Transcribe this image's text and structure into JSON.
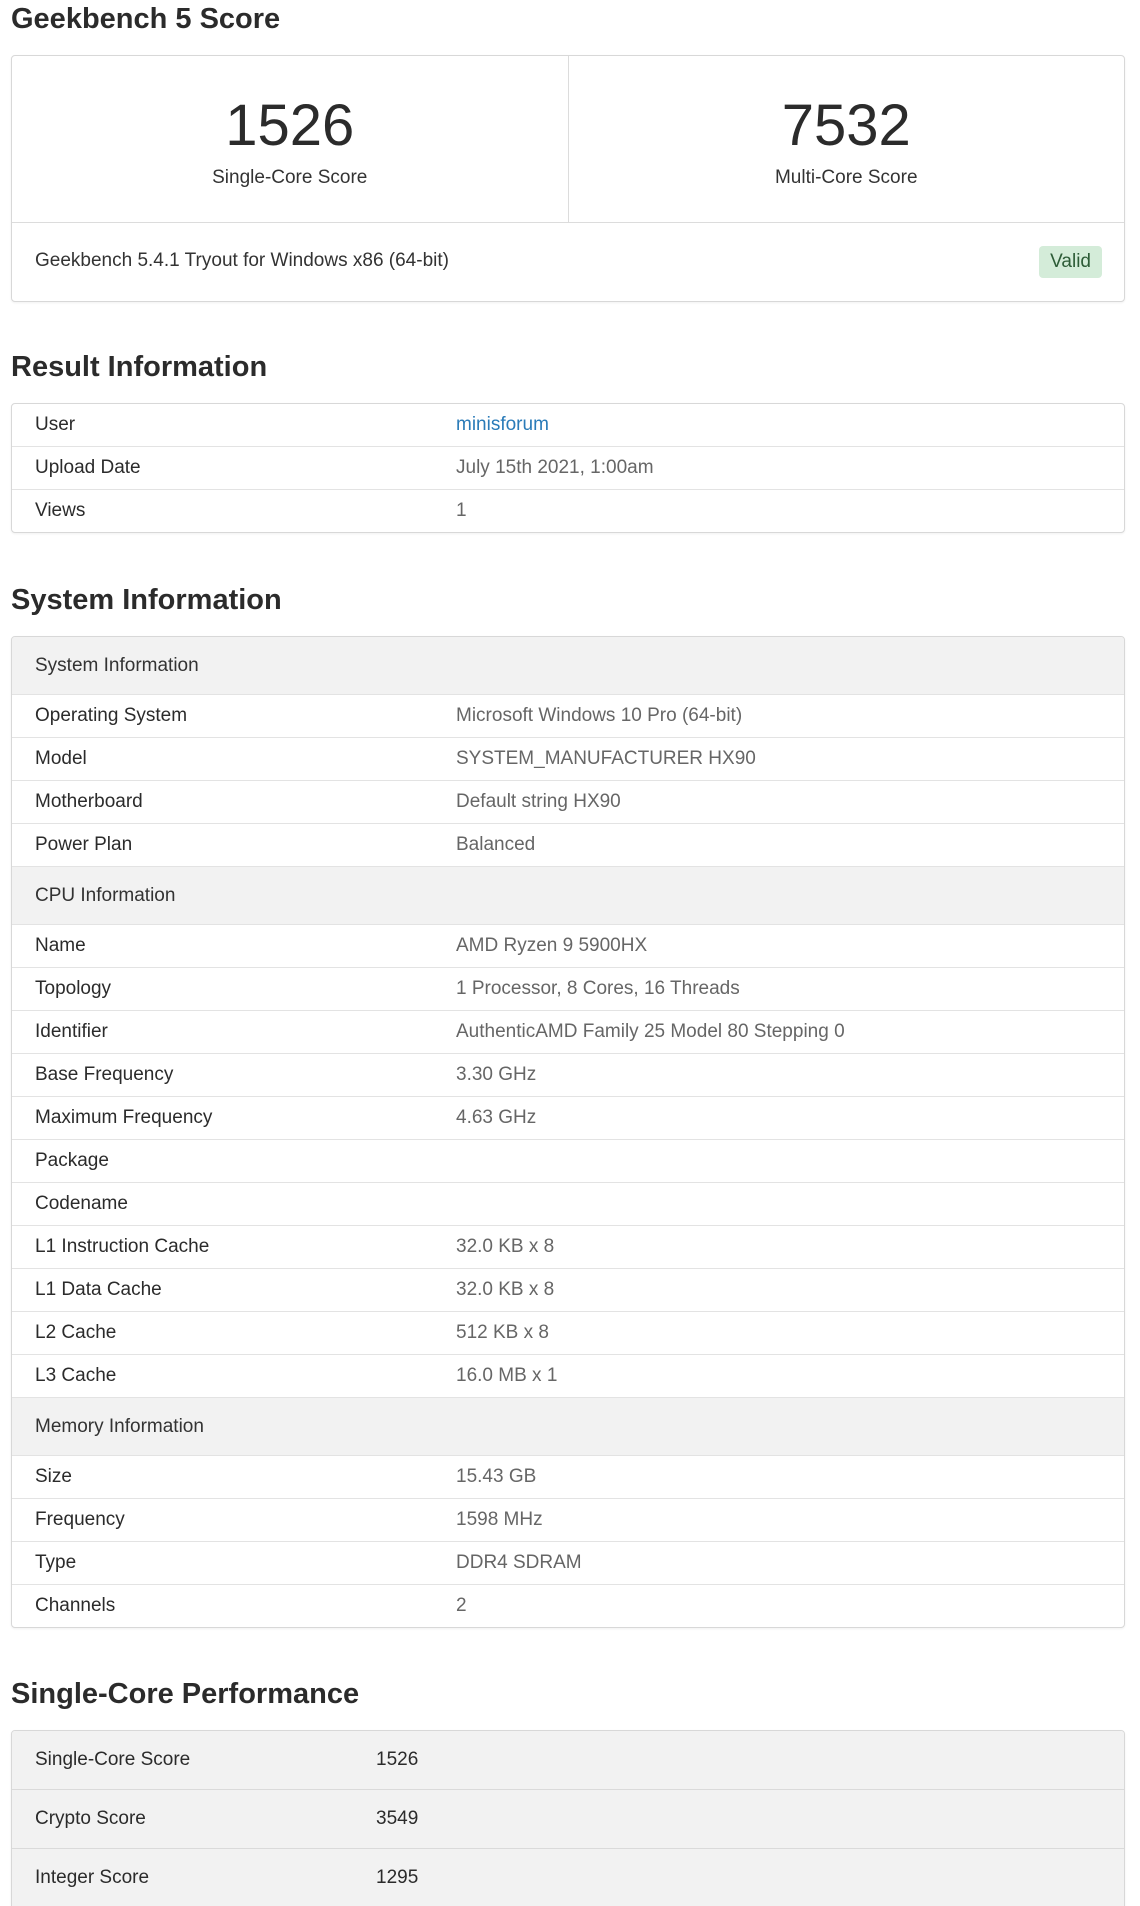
{
  "geekbench": {
    "title": "Geekbench 5 Score",
    "single_core_score": "1526",
    "single_core_label": "Single-Core Score",
    "multi_core_score": "7532",
    "multi_core_label": "Multi-Core Score",
    "version": "Geekbench 5.4.1 Tryout for Windows x86 (64-bit)",
    "validity": "Valid"
  },
  "result_info": {
    "title": "Result Information",
    "rows": [
      {
        "key": "User",
        "value": "minisforum"
      },
      {
        "key": "Upload Date",
        "value": "July 15th 2021, 1:00am"
      },
      {
        "key": "Views",
        "value": "1"
      }
    ]
  },
  "system_info": {
    "title": "System Information",
    "groups": [
      {
        "header": "System Information",
        "rows": [
          {
            "key": "Operating System",
            "value": "Microsoft Windows 10 Pro (64-bit)"
          },
          {
            "key": "Model",
            "value": "SYSTEM_MANUFACTURER HX90"
          },
          {
            "key": "Motherboard",
            "value": "Default string HX90"
          },
          {
            "key": "Power Plan",
            "value": "Balanced"
          }
        ]
      },
      {
        "header": "CPU Information",
        "rows": [
          {
            "key": "Name",
            "value": "AMD Ryzen 9 5900HX"
          },
          {
            "key": "Topology",
            "value": "1 Processor, 8 Cores, 16 Threads"
          },
          {
            "key": "Identifier",
            "value": "AuthenticAMD Family 25 Model 80 Stepping 0"
          },
          {
            "key": "Base Frequency",
            "value": "3.30 GHz"
          },
          {
            "key": "Maximum Frequency",
            "value": "4.63 GHz"
          },
          {
            "key": "Package",
            "value": ""
          },
          {
            "key": "Codename",
            "value": ""
          },
          {
            "key": "L1 Instruction Cache",
            "value": "32.0 KB x 8"
          },
          {
            "key": "L1 Data Cache",
            "value": "32.0 KB x 8"
          },
          {
            "key": "L2 Cache",
            "value": "512 KB x 8"
          },
          {
            "key": "L3 Cache",
            "value": "16.0 MB x 1"
          }
        ]
      },
      {
        "header": "Memory Information",
        "rows": [
          {
            "key": "Size",
            "value": "15.43 GB"
          },
          {
            "key": "Frequency",
            "value": "1598 MHz"
          },
          {
            "key": "Type",
            "value": "DDR4 SDRAM"
          },
          {
            "key": "Channels",
            "value": "2"
          }
        ]
      }
    ]
  },
  "single_core_perf": {
    "title": "Single-Core Performance",
    "rows": [
      {
        "key": "Single-Core Score",
        "value": "1526"
      },
      {
        "key": "Crypto Score",
        "value": "3549"
      },
      {
        "key": "Integer Score",
        "value": "1295"
      }
    ]
  }
}
